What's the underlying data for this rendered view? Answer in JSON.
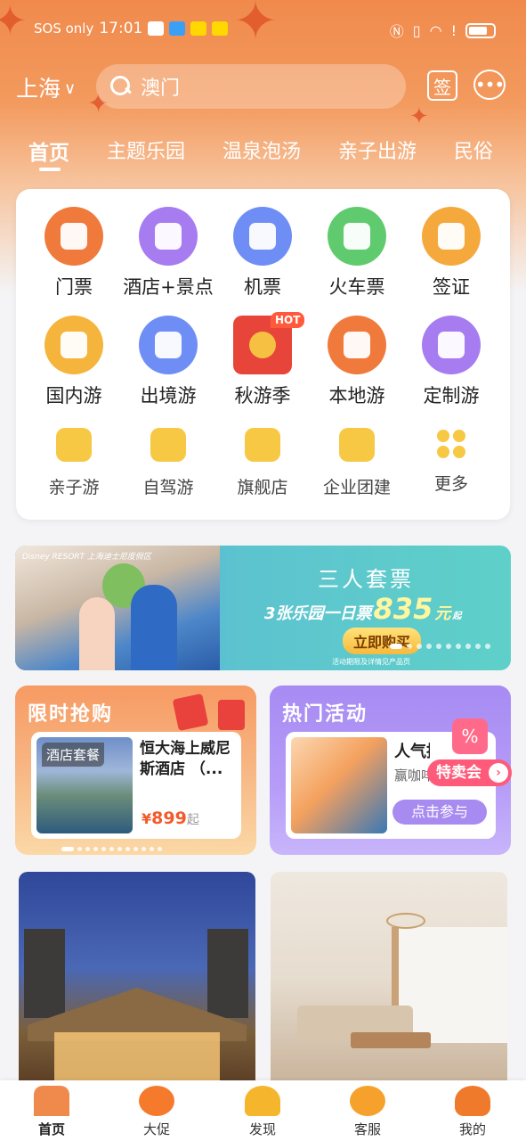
{
  "status_bar": {
    "carrier": "SOS only",
    "time": "17:01",
    "right_icons": [
      "nfc-icon",
      "vibrate-icon",
      "wifi-icon",
      "alert-icon",
      "battery-icon"
    ]
  },
  "header": {
    "city": "上海",
    "search_placeholder": "澳门",
    "sign_label": "签",
    "message_icon": "chat-bubble-icon"
  },
  "tabs": [
    {
      "label": "首页",
      "active": true
    },
    {
      "label": "主题乐园"
    },
    {
      "label": "温泉泡汤"
    },
    {
      "label": "亲子出游"
    },
    {
      "label": "民俗"
    }
  ],
  "grid": {
    "row1": [
      {
        "label": "门票",
        "icon": "ticket-icon",
        "color": "#f07a3c"
      },
      {
        "label": "酒店+景点",
        "icon": "hotel-icon",
        "color": "#a67cf0"
      },
      {
        "label": "机票",
        "icon": "plane-icon",
        "color": "#6f8ef5"
      },
      {
        "label": "火车票",
        "icon": "train-icon",
        "color": "#5fcb6e"
      },
      {
        "label": "签证",
        "icon": "visa-icon",
        "color": "#f5a93c"
      }
    ],
    "row2": [
      {
        "label": "国内游",
        "icon": "temple-icon",
        "color": "#f5b43c"
      },
      {
        "label": "出境游",
        "icon": "palm-tree-icon",
        "color": "#6f8ef5"
      },
      {
        "label": "秋游季",
        "icon": "red-envelope-icon",
        "color": "#e8453a",
        "badge": "HOT"
      },
      {
        "label": "本地游",
        "icon": "mountain-icon",
        "color": "#f07a3c"
      },
      {
        "label": "定制游",
        "icon": "custom-icon",
        "color": "#a67cf0"
      }
    ],
    "row3": [
      {
        "label": "亲子游",
        "icon": "rocking-horse-icon"
      },
      {
        "label": "自驾游",
        "icon": "car-icon"
      },
      {
        "label": "旗舰店",
        "icon": "store-icon"
      },
      {
        "label": "企业团建",
        "icon": "briefcase-icon"
      },
      {
        "label": "更多",
        "icon": "more-dots-icon"
      }
    ]
  },
  "banner": {
    "logo": "Disney RESORT 上海迪士尼度假区",
    "title": "三人套票",
    "subtitle": "3张乐园一日票",
    "price": "835",
    "unit": "元",
    "qi": "起",
    "button": "立即购买",
    "note": "活动期限及详情见产品页",
    "slides": 10,
    "active_slide": 0
  },
  "flash_sale": {
    "title": "限时抢购",
    "tag": "酒店套餐",
    "name": "恒大海上威尼斯酒店 （...",
    "price_symbol": "¥",
    "price": "899",
    "qi": "起",
    "slides": 12,
    "active_slide": 0
  },
  "hot_activity": {
    "title": "热门活动",
    "item_title": "人气抓",
    "item_sub": "赢咖啡",
    "button": "点击参与",
    "badge": "特卖会",
    "badge_arrow": "›",
    "box_symbol": "%"
  },
  "bottom_nav": [
    {
      "label": "首页",
      "icon": "home-mountain-icon",
      "color": "#f08a4c",
      "active": true
    },
    {
      "label": "大促",
      "icon": "persimmon-icon",
      "color": "#f57a2c"
    },
    {
      "label": "发现",
      "icon": "ginkgo-leaf-icon",
      "color": "#f5b52c"
    },
    {
      "label": "客服",
      "icon": "flower-icon",
      "color": "#f5a12c"
    },
    {
      "label": "我的",
      "icon": "maple-leaf-icon",
      "color": "#f07a2c"
    }
  ]
}
